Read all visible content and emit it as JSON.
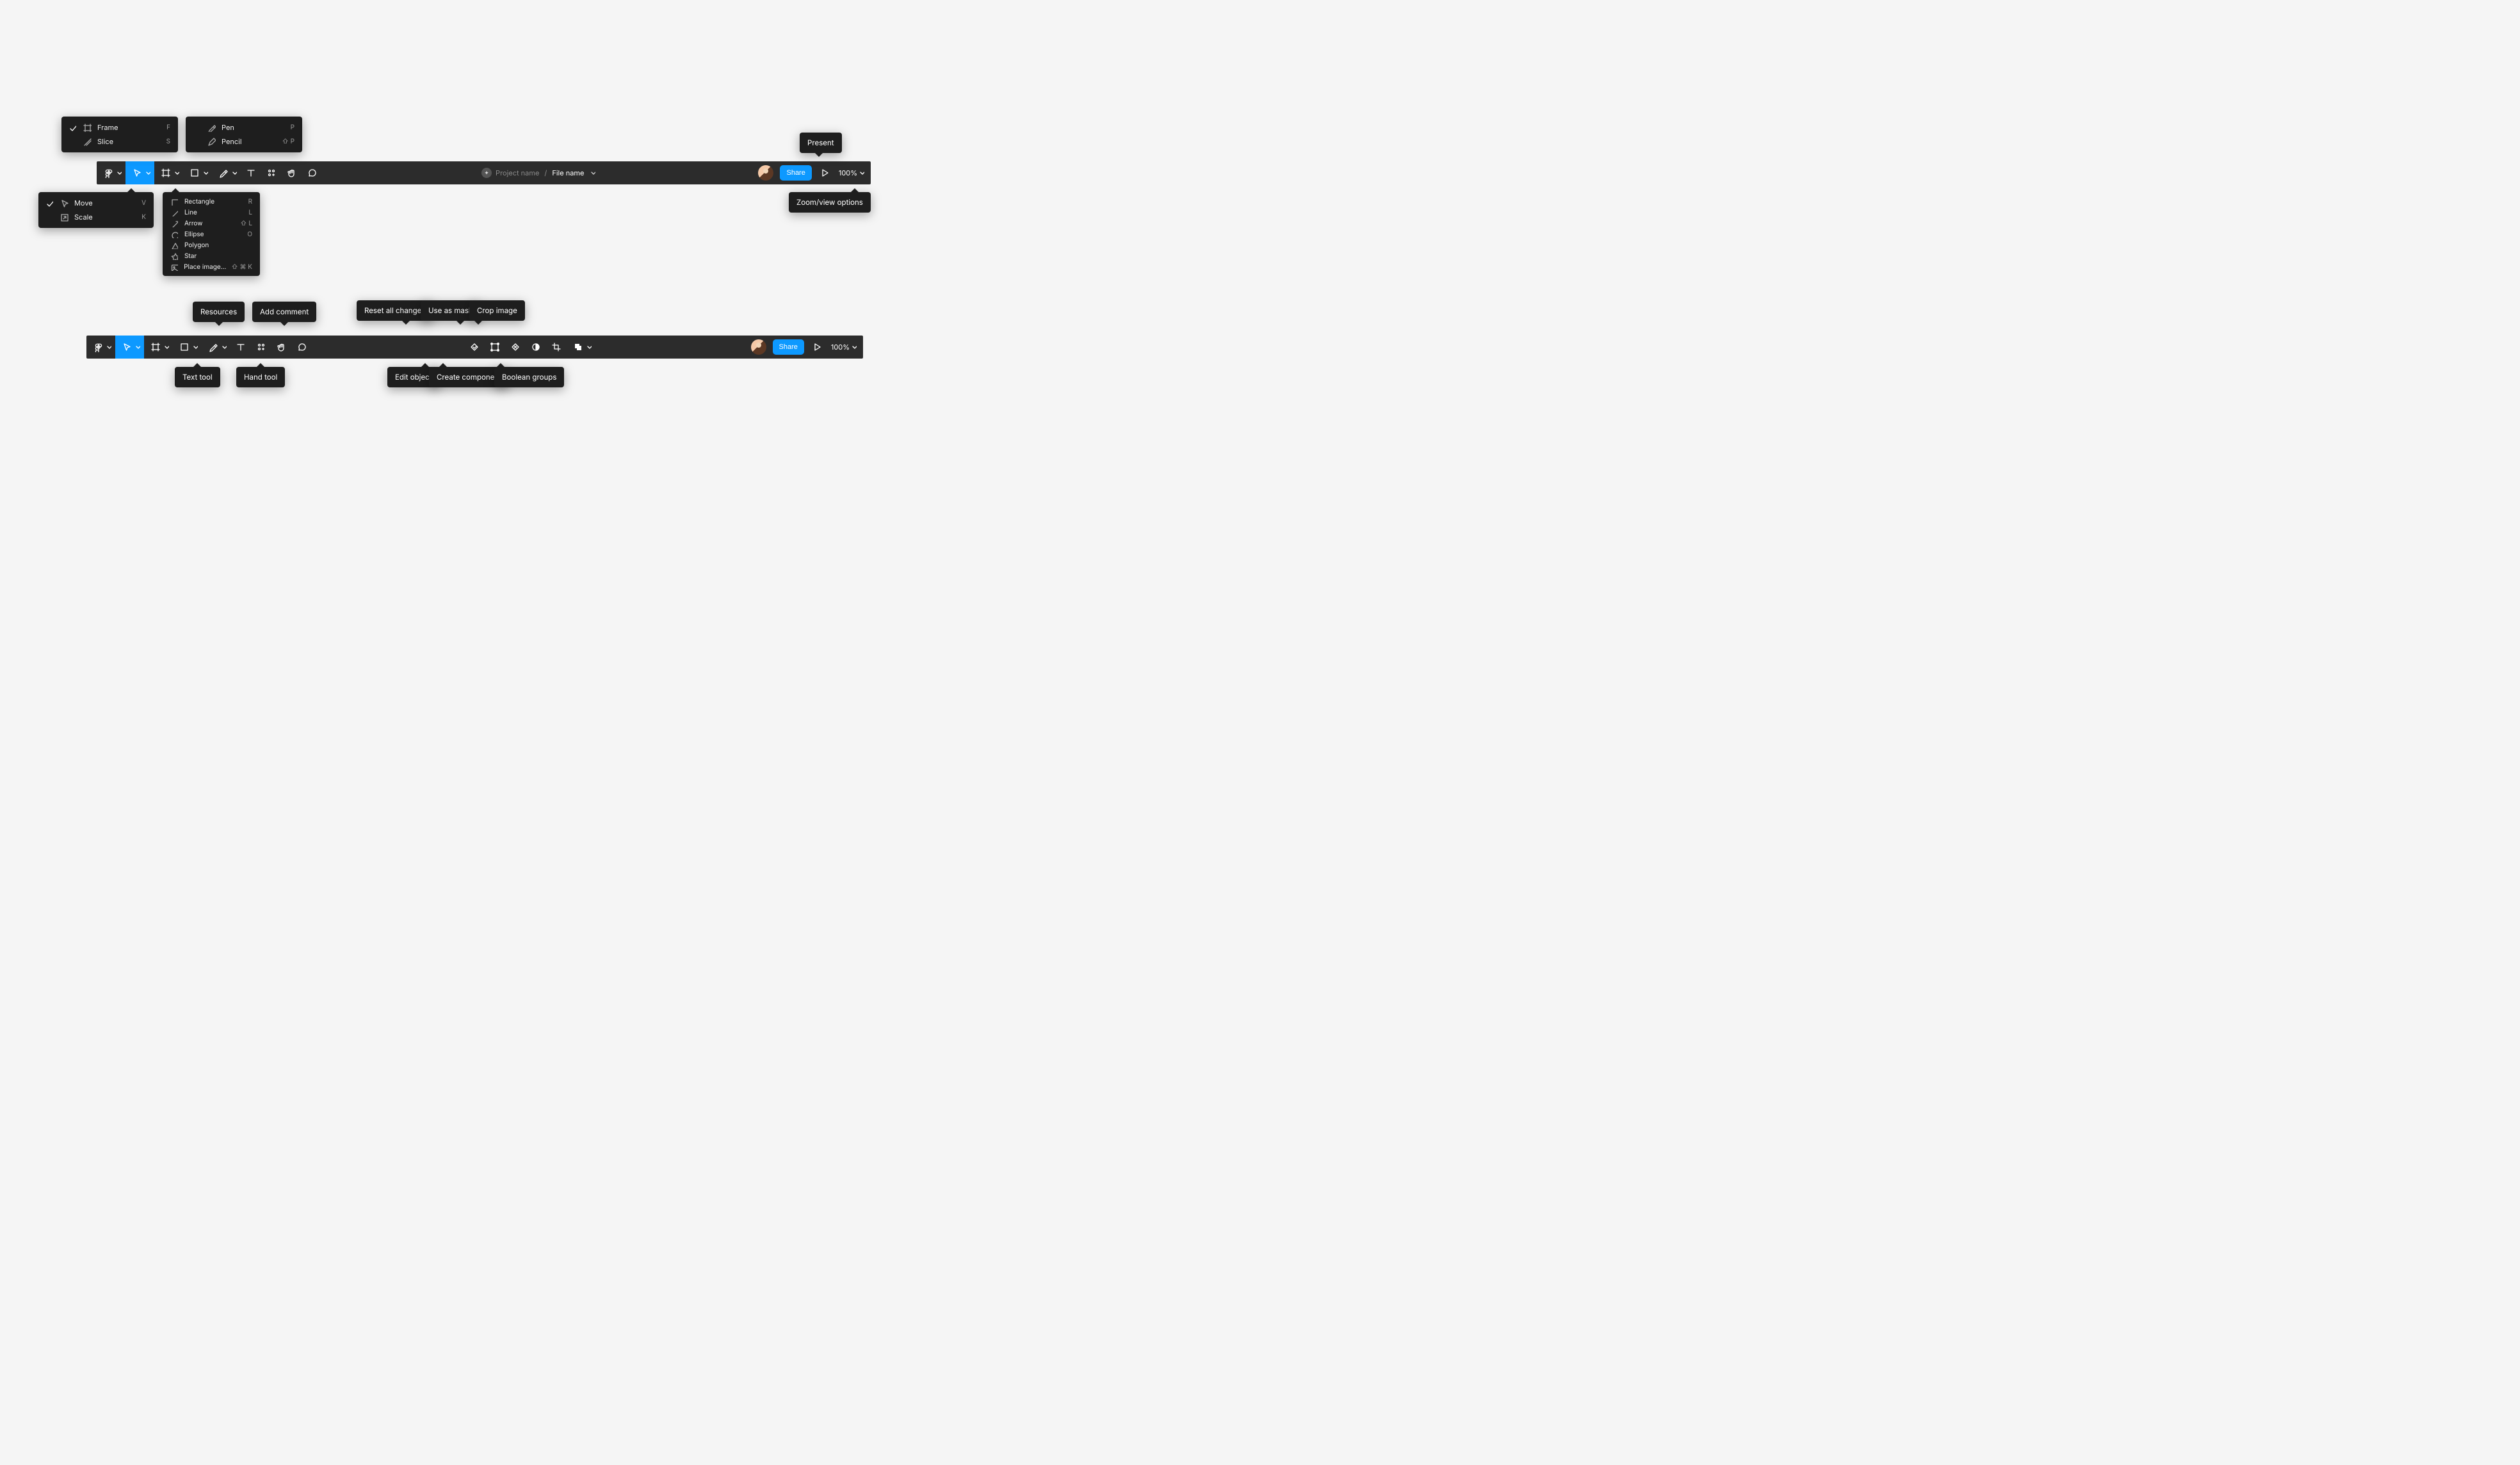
{
  "toolbar1": {
    "project_name": "Project name",
    "file_name": "File name",
    "share": "Share",
    "zoom": "100%"
  },
  "toolbar2": {
    "share": "Share",
    "zoom": "100%"
  },
  "menus": {
    "move": {
      "items": [
        {
          "label": "Move",
          "shortcut": "V",
          "checked": true
        },
        {
          "label": "Scale",
          "shortcut": "K",
          "checked": false
        }
      ]
    },
    "frame": {
      "items": [
        {
          "label": "Frame",
          "shortcut": "F",
          "checked": true
        },
        {
          "label": "Slice",
          "shortcut": "S",
          "checked": false
        }
      ]
    },
    "pen": {
      "items": [
        {
          "label": "Pen",
          "shortcut": "P"
        },
        {
          "label": "Pencil",
          "shortcut": "⇧ P"
        }
      ]
    },
    "shape": {
      "items": [
        {
          "label": "Rectangle",
          "shortcut": "R"
        },
        {
          "label": "Line",
          "shortcut": "L"
        },
        {
          "label": "Arrow",
          "shortcut": "⇧ L"
        },
        {
          "label": "Ellipse",
          "shortcut": "O"
        },
        {
          "label": "Polygon",
          "shortcut": ""
        },
        {
          "label": "Star",
          "shortcut": ""
        },
        {
          "label": "Place image…",
          "shortcut": "⇧ ⌘ K"
        }
      ]
    }
  },
  "tooltips": {
    "present": "Present",
    "zoom_view": "Zoom/view options",
    "resources": "Resources",
    "add_comment": "Add comment",
    "reset_all": "Reset all changes",
    "use_as_mask": "Use as mask",
    "crop_image": "Crop image",
    "text_tool": "Text tool",
    "hand_tool": "Hand tool",
    "edit_object": "Edit object",
    "create_component": "Create component",
    "boolean_groups": "Boolean groups"
  }
}
